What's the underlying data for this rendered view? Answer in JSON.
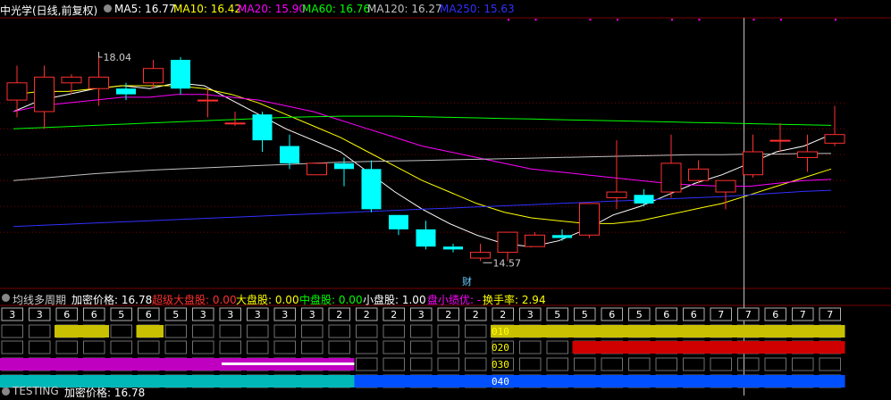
{
  "header": {
    "title": "中光学(日线,前复权)",
    "indicators": [
      {
        "label": "MA5: 16.77",
        "color": "#ffffff"
      },
      {
        "label": "MA10: 16.42",
        "color": "#ffff00"
      },
      {
        "label": "MA20: 15.90",
        "color": "#ff00ff"
      },
      {
        "label": "MA60: 16.76",
        "color": "#00ff00"
      },
      {
        "label": "MA120: 16.27",
        "color": "#c0c0c0"
      },
      {
        "label": "MA250: 15.63",
        "color": "#3030ff"
      }
    ]
  },
  "annotations": {
    "high_label": "18.04",
    "low_label": "14.57",
    "cai_label": "财"
  },
  "sub_header": {
    "title": "均线多周期",
    "items": [
      {
        "label": "加密价格: 16.78",
        "color": "#ffffff"
      },
      {
        "label": "超级大盘股: 0.00",
        "color": "#ff3030"
      },
      {
        "label": "大盘股: 0.00",
        "color": "#ffff00"
      },
      {
        "label": "中盘股: 0.00",
        "color": "#00ff00"
      },
      {
        "label": "小盘股: 1.00",
        "color": "#ffffff"
      },
      {
        "label": "盘小绩优: -",
        "color": "#ff00ff"
      },
      {
        "label": "换手率: 2.94",
        "color": "#ffff00"
      }
    ]
  },
  "bottom_header": {
    "title": "TESTING",
    "item": "加密价格: 16.78"
  },
  "chart_data": {
    "type": "candlestick",
    "ylim": [
      14.0,
      18.6
    ],
    "candles": [
      [
        17.2,
        17.5,
        17.8,
        16.9
      ],
      [
        17.0,
        17.6,
        17.8,
        16.7
      ],
      [
        17.5,
        17.6,
        17.65,
        17.3
      ],
      [
        17.4,
        17.6,
        18.04,
        17.1
      ],
      [
        17.4,
        17.3,
        17.5,
        17.2
      ],
      [
        17.5,
        17.75,
        17.9,
        17.4
      ],
      [
        17.9,
        17.4,
        17.95,
        17.3
      ],
      [
        17.2,
        17.2,
        17.4,
        16.9
      ],
      [
        16.8,
        16.8,
        17.0,
        16.75
      ],
      [
        16.95,
        16.5,
        17.0,
        16.3
      ],
      [
        16.4,
        16.1,
        16.6,
        16.0
      ],
      [
        15.9,
        16.1,
        16.1,
        15.9
      ],
      [
        16.1,
        16.0,
        16.2,
        15.7
      ],
      [
        16.0,
        15.3,
        16.15,
        15.25
      ],
      [
        15.2,
        14.95,
        15.2,
        14.85
      ],
      [
        14.95,
        14.65,
        15.1,
        14.6
      ],
      [
        14.65,
        14.6,
        14.7,
        14.55
      ],
      [
        14.45,
        14.55,
        14.7,
        14.4
      ],
      [
        14.55,
        14.9,
        14.9,
        14.4
      ],
      [
        14.65,
        14.85,
        14.9,
        14.65
      ],
      [
        14.85,
        14.8,
        14.95,
        14.75
      ],
      [
        14.85,
        15.4,
        15.4,
        14.8
      ],
      [
        15.5,
        15.6,
        16.5,
        15.3
      ],
      [
        15.55,
        15.4,
        15.65,
        15.35
      ],
      [
        15.6,
        16.1,
        16.6,
        15.5
      ],
      [
        15.8,
        16.0,
        16.15,
        15.75
      ],
      [
        15.6,
        15.8,
        15.8,
        15.3
      ],
      [
        15.9,
        16.3,
        16.6,
        15.85
      ],
      [
        16.5,
        16.5,
        16.8,
        16.3
      ],
      [
        16.2,
        16.3,
        16.6,
        15.95
      ],
      [
        16.45,
        16.6,
        17.1,
        16.4
      ]
    ],
    "ma_lines": [
      {
        "name": "MA5",
        "color": "#ffffff",
        "values": [
          17.0,
          17.2,
          17.3,
          17.4,
          17.45,
          17.4,
          17.5,
          17.45,
          17.2,
          16.95,
          16.7,
          16.5,
          16.3,
          15.95,
          15.6,
          15.3,
          15.05,
          14.85,
          14.7,
          14.65,
          14.75,
          14.95,
          15.2,
          15.35,
          15.55,
          15.75,
          15.9,
          16.1,
          16.3,
          16.4,
          16.6
        ]
      },
      {
        "name": "MA10",
        "color": "#ffff00",
        "values": [
          17.3,
          17.35,
          17.35,
          17.4,
          17.45,
          17.45,
          17.45,
          17.4,
          17.3,
          17.15,
          16.95,
          16.75,
          16.55,
          16.3,
          16.05,
          15.8,
          15.6,
          15.4,
          15.25,
          15.15,
          15.1,
          15.05,
          15.05,
          15.1,
          15.2,
          15.3,
          15.4,
          15.55,
          15.7,
          15.85,
          16.0
        ]
      },
      {
        "name": "MA20",
        "color": "#ff00ff",
        "values": [
          17.0,
          17.1,
          17.15,
          17.2,
          17.25,
          17.25,
          17.3,
          17.3,
          17.25,
          17.2,
          17.1,
          17.0,
          16.85,
          16.7,
          16.55,
          16.4,
          16.3,
          16.2,
          16.1,
          16.0,
          15.95,
          15.9,
          15.85,
          15.8,
          15.75,
          15.72,
          15.7,
          15.7,
          15.75,
          15.8,
          15.82
        ]
      },
      {
        "name": "MA60",
        "color": "#00ff00",
        "values": [
          16.7,
          16.72,
          16.74,
          16.76,
          16.78,
          16.8,
          16.82,
          16.84,
          16.86,
          16.88,
          16.9,
          16.91,
          16.92,
          16.92,
          16.92,
          16.91,
          16.9,
          16.89,
          16.88,
          16.87,
          16.86,
          16.85,
          16.84,
          16.83,
          16.82,
          16.81,
          16.8,
          16.79,
          16.78,
          16.77,
          16.76
        ]
      },
      {
        "name": "MA120",
        "color": "#c0c0c0",
        "values": [
          15.8,
          15.84,
          15.88,
          15.92,
          15.95,
          15.98,
          16.0,
          16.02,
          16.04,
          16.06,
          16.08,
          16.1,
          16.12,
          16.13,
          16.14,
          16.15,
          16.16,
          16.17,
          16.18,
          16.19,
          16.2,
          16.21,
          16.22,
          16.23,
          16.24,
          16.25,
          16.25,
          16.26,
          16.26,
          16.27,
          16.27
        ]
      },
      {
        "name": "MA250",
        "color": "#3030ff",
        "values": [
          15.0,
          15.02,
          15.04,
          15.06,
          15.08,
          15.1,
          15.12,
          15.14,
          15.16,
          15.18,
          15.2,
          15.22,
          15.24,
          15.26,
          15.28,
          15.3,
          15.32,
          15.34,
          15.36,
          15.38,
          15.4,
          15.42,
          15.44,
          15.46,
          15.48,
          15.5,
          15.52,
          15.55,
          15.58,
          15.61,
          15.63
        ]
      }
    ],
    "cycle_numbers": [
      "3",
      "3",
      "6",
      "6",
      "5",
      "6",
      "5",
      "3",
      "3",
      "3",
      "3",
      "3",
      "2",
      "2",
      "2",
      "3",
      "2",
      "2",
      "2",
      "3",
      "5",
      "5",
      "6",
      "5",
      "6",
      "6",
      "7",
      "7",
      "6",
      "7",
      "7"
    ],
    "bands": [
      {
        "label": "010",
        "segments": [
          {
            "from": 2,
            "to": 4,
            "color": "#c8c000"
          },
          {
            "from": 5,
            "to": 6,
            "color": "#c8c000"
          },
          {
            "from": 18,
            "to": 31,
            "color": "#c8c000"
          }
        ]
      },
      {
        "label": "020",
        "segments": [
          {
            "from": 21,
            "to": 31,
            "color": "#d00000"
          }
        ]
      },
      {
        "label": "030",
        "segments": [
          {
            "from": 0,
            "to": 13,
            "color": "#c000c0"
          },
          {
            "from": 8,
            "to": 13,
            "color": "#ffffff",
            "thin": true
          }
        ]
      },
      {
        "label": "040",
        "segments": [
          {
            "from": 0,
            "to": 13,
            "color": "#00b8b8"
          },
          {
            "from": 13,
            "to": 31,
            "color": "#0050ff"
          }
        ]
      }
    ]
  }
}
